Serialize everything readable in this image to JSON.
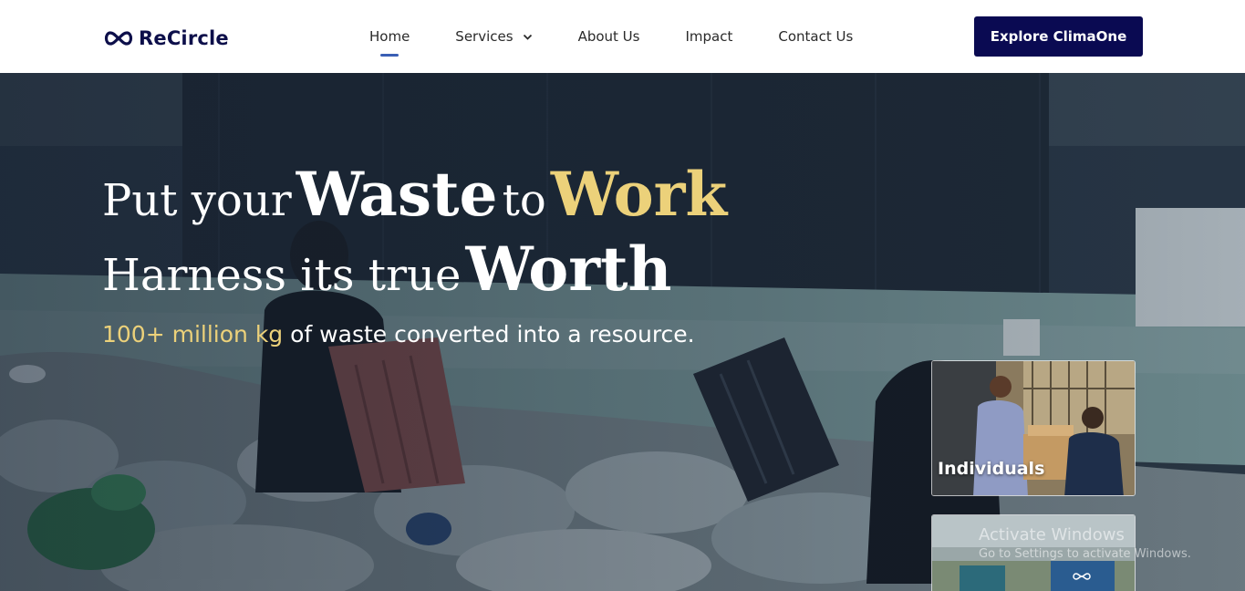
{
  "brand": {
    "name": "ReCircle"
  },
  "nav": {
    "items": [
      {
        "label": "Home",
        "active": true
      },
      {
        "label": "Services",
        "has_dropdown": true
      },
      {
        "label": "About Us"
      },
      {
        "label": "Impact"
      },
      {
        "label": "Contact Us"
      }
    ],
    "cta_label": "Explore ClimaOne"
  },
  "hero": {
    "line1": {
      "a": "Put your",
      "b": "Waste",
      "c": "to",
      "d": "Work"
    },
    "line2": {
      "a": "Harness its true",
      "b": "Worth"
    },
    "subline": {
      "highlight": "100+ million kg",
      "rest": "of waste converted into a resource."
    },
    "cards": [
      {
        "label": "Individuals"
      }
    ]
  },
  "os_watermark": {
    "title": "Activate Windows",
    "subtitle": "Go to Settings to activate Windows."
  },
  "colors": {
    "brand_navy": "#0a0a52",
    "accent_gold": "#ecd17a",
    "nav_underline": "#3a5fb5"
  }
}
